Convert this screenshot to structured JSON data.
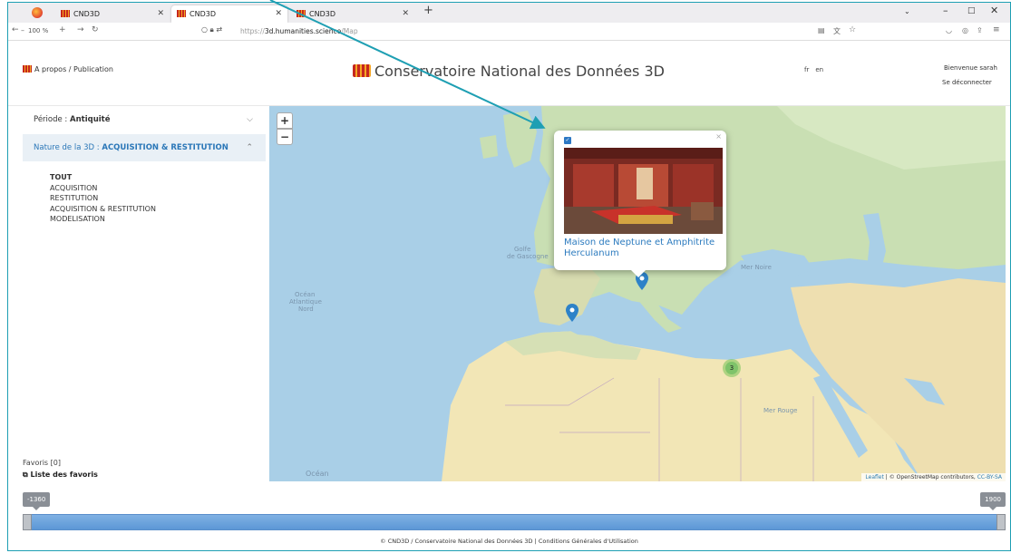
{
  "browser": {
    "tabs": [
      {
        "label": "CND3D",
        "active": false
      },
      {
        "label": "CND3D",
        "active": true
      },
      {
        "label": "CND3D",
        "active": false
      }
    ],
    "zoom": "100 %",
    "url_prefix": "https://",
    "url_domain": "3d.humanities.science",
    "url_path": "/Map"
  },
  "header": {
    "about": "A propos / Publication",
    "title": "Conservatoire National des Données 3D",
    "lang": [
      "fr",
      "en"
    ],
    "welcome": "Bienvenue sarah",
    "logout": "Se déconnecter"
  },
  "sidebar": {
    "periode_label": "Période : ",
    "periode_value": "Antiquité",
    "nature_label": "Nature de la 3D : ",
    "nature_value": "ACQUISITION & RESTITUTION",
    "nature_options": [
      "TOUT",
      "ACQUISITION",
      "RESTITUTION",
      "ACQUISITION & RESTITUTION",
      "MODELISATION"
    ],
    "favorites": "Favoris [0]",
    "favorites_list": "Liste des favoris"
  },
  "map": {
    "zoom_in": "+",
    "zoom_out": "−",
    "popup_title": "Maison de Neptune et Amphitrite Herculanum",
    "cluster_count": "3",
    "attribution_leaflet": "Leaflet",
    "attribution_osm": " | © OpenStreetMap contributors, ",
    "attribution_license": "CC-BY-SA",
    "labels": [
      "Océan Atlantique Nord",
      "Golfe de Gascogne",
      "Mer Noire",
      "Mer Rouge",
      "Océan"
    ]
  },
  "timeline": {
    "min": "-1360",
    "max": "1900"
  },
  "footer": "© CND3D / Conservatoire National des Données 3D | Conditions Générales d'Utilisation",
  "colors": {
    "accent": "#2c7bbf",
    "frame": "#1e9fb3",
    "slider": "#6fa6de"
  }
}
